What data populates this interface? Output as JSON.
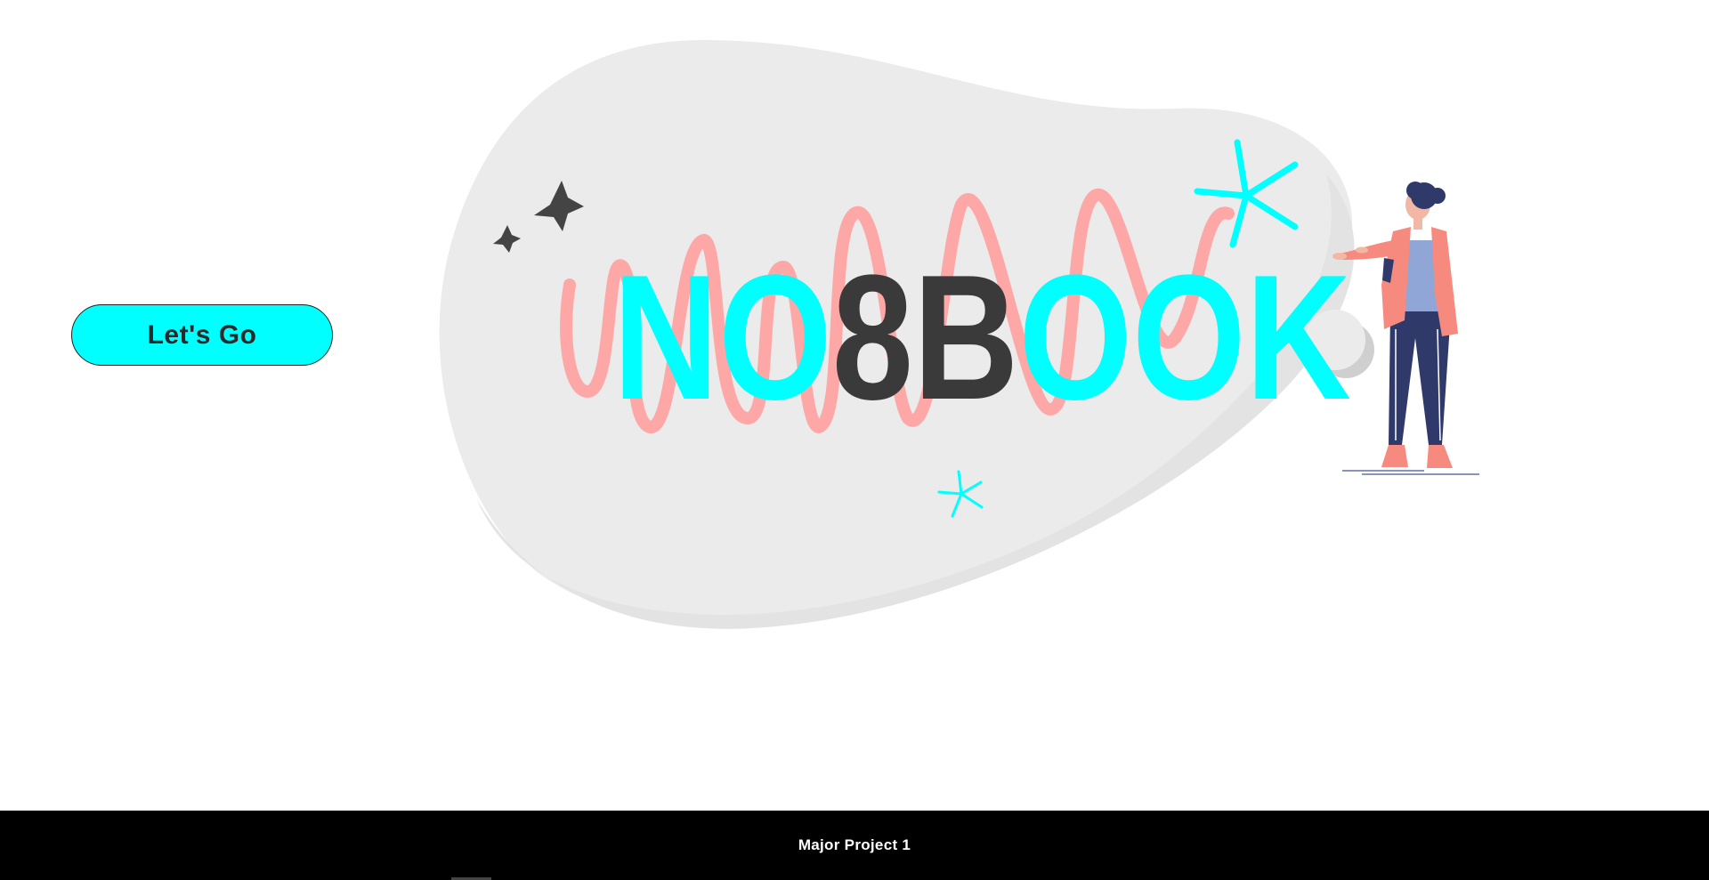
{
  "hero": {
    "logo": {
      "text": "NO8BOOK",
      "part_start": "NO",
      "part_mid": "8B",
      "part_end": "OOK",
      "accent_color": "#00ffff",
      "dark_color": "#3a3a3a"
    },
    "cta_label": "Let's Go"
  },
  "footer": {
    "text": "Major Project 1"
  },
  "colors": {
    "accent": "#00ffff",
    "blob": "#ebebeb",
    "scribble": "#ffa3a3",
    "coat": "#f78a7e",
    "pants": "#2f3a6b",
    "dark": "#3a3a3a"
  },
  "icons": [
    "sparkle-star-icon",
    "asterisk-burst-icon",
    "woman-presenting-illustration"
  ]
}
